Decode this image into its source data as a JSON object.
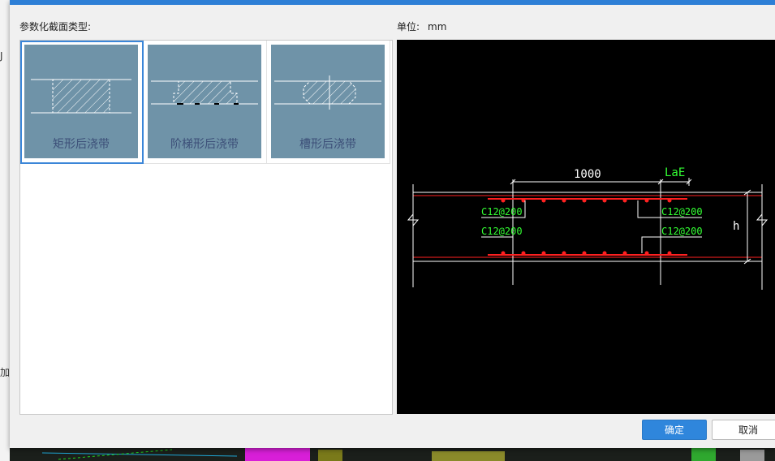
{
  "dialog": {
    "section_label": "参数化截面类型:",
    "unit_label": "单位:",
    "unit_value": "mm",
    "types": [
      {
        "label": "矩形后浇带",
        "selected": true
      },
      {
        "label": "阶梯形后浇带",
        "selected": false
      },
      {
        "label": "槽形后浇带",
        "selected": false
      }
    ],
    "preview": {
      "dim_width": "1000",
      "dim_anchor": "LaE",
      "top_left_rebar": "C12@200",
      "top_right_rebar": "C12@200",
      "bottom_left_rebar": "C12@200",
      "bottom_right_rebar": "C12@200",
      "height_label": "h",
      "colors": {
        "rebar": "#ff2020",
        "annotation": "#33ff33",
        "lines": "#ffffff"
      }
    },
    "buttons": {
      "ok": "确定",
      "cancel": "取消"
    }
  },
  "background": {
    "fragments": [
      "J",
      "加"
    ]
  }
}
